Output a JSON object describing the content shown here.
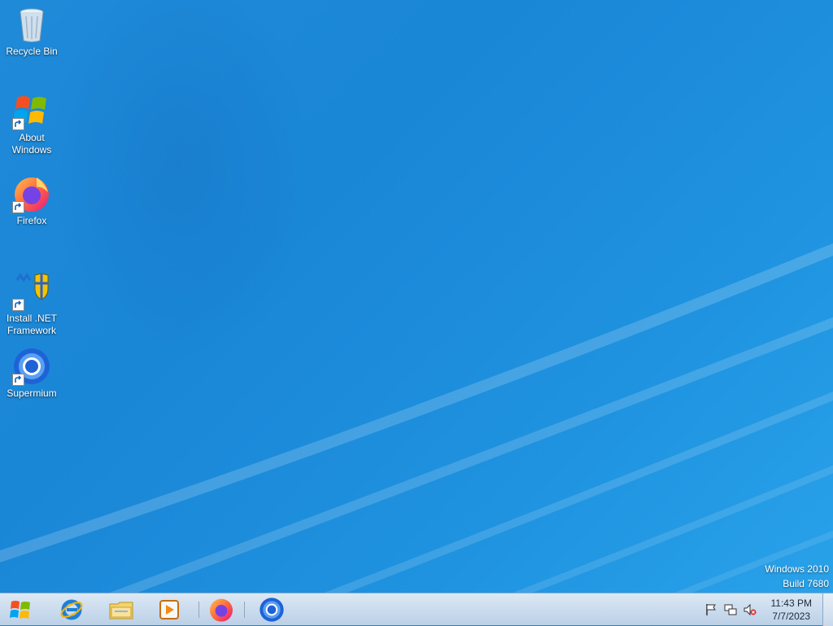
{
  "desktop": {
    "icons": [
      {
        "label": "Recycle Bin",
        "icon": "recycle-bin-icon"
      },
      {
        "label": "About Windows",
        "icon": "windows-logo-icon"
      },
      {
        "label": "Firefox",
        "icon": "firefox-icon"
      },
      {
        "label": "Install .NET Framework",
        "icon": "dotnet-installer-icon"
      },
      {
        "label": "Supermium",
        "icon": "supermium-icon"
      }
    ],
    "watermark": {
      "line1": "Windows 2010",
      "line2": "Build 7680"
    }
  },
  "taskbar": {
    "start": {
      "icon": "windows-start-icon"
    },
    "pinned": [
      {
        "name": "internet-explorer",
        "icon": "internet-explorer-icon"
      },
      {
        "name": "file-explorer",
        "icon": "folder-icon"
      },
      {
        "name": "media-player",
        "icon": "media-player-icon"
      },
      {
        "name": "firefox",
        "icon": "firefox-icon"
      },
      {
        "name": "supermium",
        "icon": "supermium-icon"
      }
    ],
    "tray": {
      "icons": [
        "action-center-flag-icon",
        "network-icon",
        "volume-muted-icon"
      ],
      "time": "11:43 PM",
      "date": "7/7/2023"
    }
  }
}
